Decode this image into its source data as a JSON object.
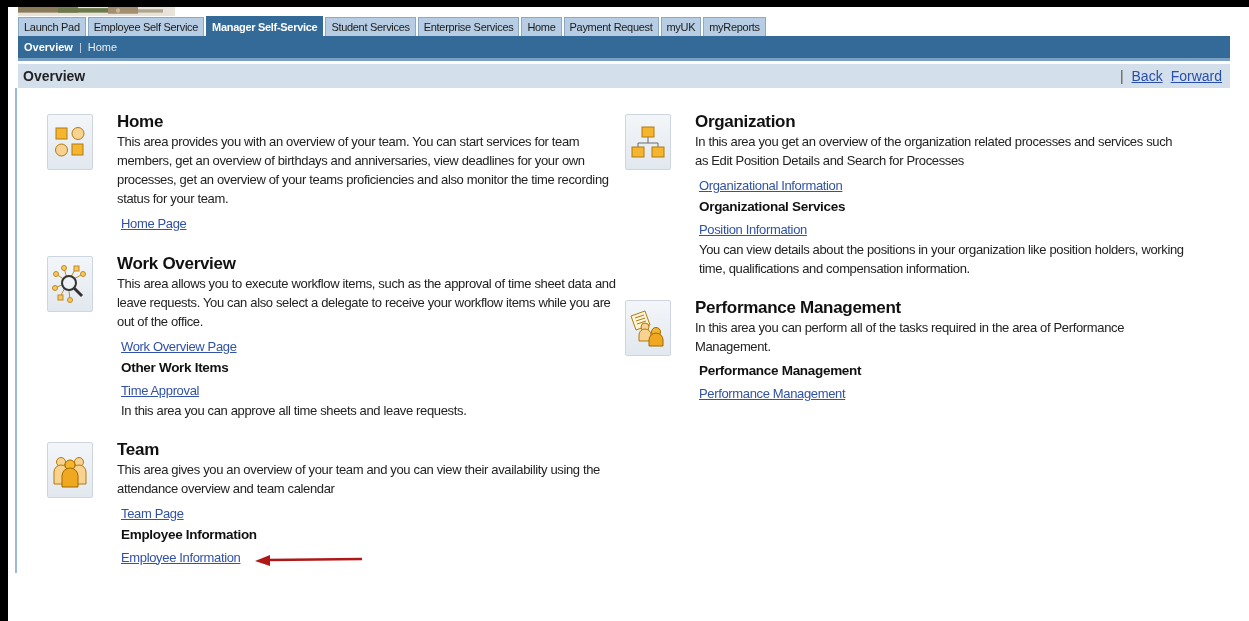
{
  "tabs": [
    {
      "label": "Launch Pad",
      "selected": false
    },
    {
      "label": "Employee Self Service",
      "selected": false
    },
    {
      "label": "Manager Self-Service",
      "selected": true
    },
    {
      "label": "Student Services",
      "selected": false
    },
    {
      "label": "Enterprise Services",
      "selected": false
    },
    {
      "label": "Home",
      "selected": false
    },
    {
      "label": "Payment Request",
      "selected": false
    },
    {
      "label": "myUK",
      "selected": false
    },
    {
      "label": "myReports",
      "selected": false
    }
  ],
  "subnav": {
    "separator": "|",
    "items": [
      {
        "label": "Overview",
        "selected": true
      },
      {
        "label": "Home",
        "selected": false
      }
    ]
  },
  "page_header": {
    "title": "Overview",
    "separator": "|",
    "links": [
      "Back",
      "Forward"
    ]
  },
  "columns": [
    {
      "sections": [
        {
          "title": "Home",
          "description": "This area provides you with an overview of your team. You can start services for team members, get an overview of birthdays and anniversaries, view deadlines for your own processes, get an overview of your teams proficiencies and also monitor the time recording status for your team.",
          "items": [
            {
              "kind": "link",
              "text": "Home Page"
            }
          ]
        },
        {
          "title": "Work Overview",
          "description": "This area allows you to execute workflow items, such as the approval of time sheet data and leave requests. You can also select a delegate to receive your workflow items while you are out of the office.",
          "items": [
            {
              "kind": "link",
              "text": "Work Overview Page"
            },
            {
              "kind": "heading",
              "text": "Other Work Items"
            },
            {
              "kind": "link",
              "text": "Time Approval"
            },
            {
              "kind": "text",
              "text": "In this area you can approve all time sheets and leave requests."
            }
          ]
        },
        {
          "title": "Team",
          "description": "This area gives you an overview of your team and you can view their availability using the attendance overview and team calendar",
          "items": [
            {
              "kind": "link",
              "text": "Team Page"
            },
            {
              "kind": "heading",
              "text": "Employee Information"
            },
            {
              "kind": "link",
              "text": "Employee Information",
              "pointer": true
            }
          ]
        }
      ]
    },
    {
      "sections": [
        {
          "title": "Organization",
          "description": "In this area you get an overview of the organization related processes and services such as Edit Position Details and Search for Processes",
          "items": [
            {
              "kind": "link",
              "text": "Organizational Information"
            },
            {
              "kind": "heading",
              "text": "Organizational Services"
            },
            {
              "kind": "link",
              "text": "Position Information"
            },
            {
              "kind": "text",
              "text": "You can view details about the positions in your organization like position holders, working time, qualifications and compensation information."
            }
          ]
        },
        {
          "title": "Performance Management",
          "description": "In this area you can perform all of the tasks required in the area of Performance Management.",
          "items": [
            {
              "kind": "heading",
              "text": "Performance Management"
            },
            {
              "kind": "link",
              "text": "Performance Management"
            }
          ]
        }
      ]
    }
  ]
}
